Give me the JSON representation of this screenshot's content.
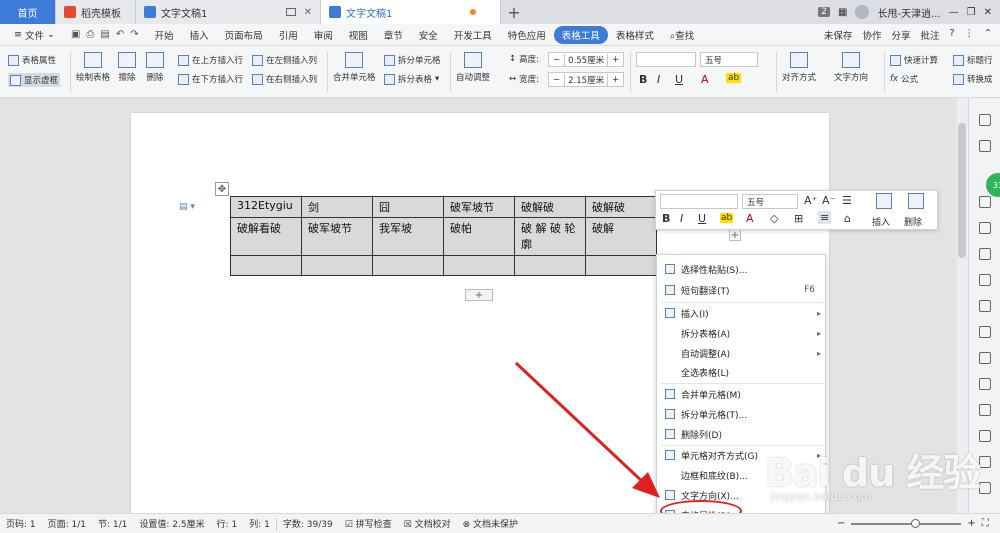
{
  "titlebar": {
    "tabs": [
      {
        "label": "首页",
        "icon": "home"
      },
      {
        "label": "稻壳模板",
        "icon": "docer-icon"
      },
      {
        "label": "文字文稿1",
        "icon": "wps-doc-icon"
      },
      {
        "label": "文字文稿1",
        "icon": "wps-doc-icon"
      }
    ],
    "badge": "2",
    "user": "长甩-天津逍..."
  },
  "menubar": {
    "file": "文件",
    "items": [
      "开始",
      "插入",
      "页面布局",
      "引用",
      "审阅",
      "视图",
      "章节",
      "安全",
      "开发工具",
      "特色应用",
      "表格工具",
      "表格样式"
    ],
    "active": "表格工具",
    "search": "查找",
    "right": [
      "未保存",
      "协作",
      "分享",
      "批注"
    ]
  },
  "ribbon": {
    "table_props": "表格属性",
    "show_grid": "显示虚框",
    "draw_table": "绘制表格",
    "erase": "擦除",
    "delete": "删除",
    "ins_above": "在上方插入行",
    "ins_below": "在下方插入行",
    "ins_left": "在左侧插入列",
    "ins_right": "在右侧插入列",
    "merge": "合并单元格",
    "split_cell": "拆分单元格",
    "split_table": "拆分表格",
    "autofit": "自动调整",
    "height_label": "高度:",
    "height_val": "0.55厘米",
    "width_label": "宽度:",
    "width_val": "2.15厘米",
    "font_size": "五号",
    "align": "对齐方式",
    "text_dir": "文字方向",
    "quick_calc": "快速计算",
    "formula": "公式",
    "title_row": "标题行",
    "convert": "转换成"
  },
  "table": {
    "rows": [
      [
        "312Etygiu",
        "剑",
        "囧",
        "破军坡节",
        "破解破",
        "破解破"
      ],
      [
        "破解看破",
        "破军坡节",
        "我军坡",
        "破帕",
        "破 解 破 轮 廓",
        "破解"
      ],
      [
        "",
        "",
        "",
        "",
        "",
        ""
      ]
    ]
  },
  "minibar": {
    "font_size": "五号",
    "insert": "插入",
    "delete": "删除"
  },
  "context_menu": {
    "items": [
      {
        "label": "选择性粘贴(S)...",
        "shortcut": "",
        "arrow": false
      },
      {
        "label": "短句翻译(T)",
        "shortcut": "F6",
        "arrow": false
      },
      {
        "label": "插入(I)",
        "shortcut": "",
        "arrow": true
      },
      {
        "label": "拆分表格(A)",
        "shortcut": "",
        "arrow": true
      },
      {
        "label": "自动调整(A)",
        "shortcut": "",
        "arrow": true
      },
      {
        "label": "全选表格(L)",
        "shortcut": "",
        "arrow": false
      },
      {
        "label": "合并单元格(M)",
        "shortcut": "",
        "arrow": false
      },
      {
        "label": "拆分单元格(T)...",
        "shortcut": "",
        "arrow": false
      },
      {
        "label": "删除列(D)",
        "shortcut": "",
        "arrow": false
      },
      {
        "label": "单元格对齐方式(G)",
        "shortcut": "",
        "arrow": true
      },
      {
        "label": "边框和底纹(B)...",
        "shortcut": "",
        "arrow": false
      },
      {
        "label": "文字方向(X)...",
        "shortcut": "",
        "arrow": false
      },
      {
        "label": "表格属性(R)...",
        "shortcut": "",
        "arrow": false
      }
    ]
  },
  "watermark": {
    "main": "Bai du 经验",
    "sub": "jingyan.baidu.com"
  },
  "status": {
    "items": [
      "页码: 1",
      "页面: 1/1",
      "节: 1/1",
      "设置值: 2.5厘米",
      "行: 1",
      "列: 1",
      "字数: 39/39",
      "拼写检查",
      "文档校对",
      "文档未保护"
    ]
  },
  "colors": {
    "accent": "#3d7bd9",
    "highlight": "#e02020",
    "arrow": "#e02020"
  }
}
